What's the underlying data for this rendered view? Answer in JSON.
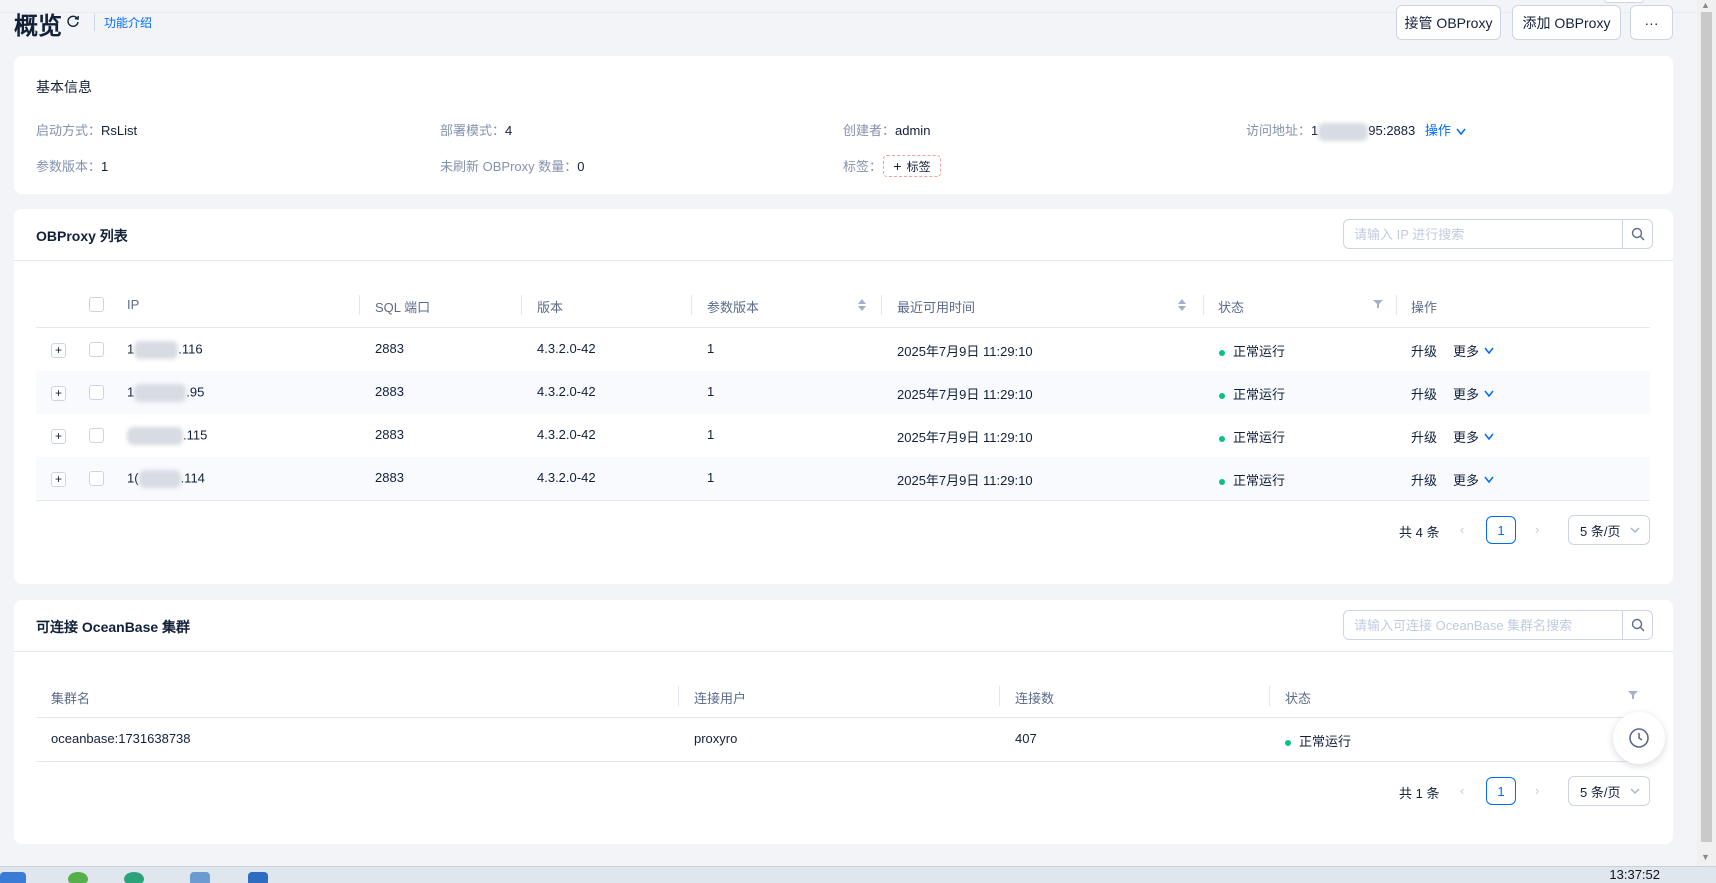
{
  "header": {
    "title": "概览",
    "intro_link": "功能介绍",
    "btn_takeover": "接管 OBProxy",
    "btn_add": "添加 OBProxy",
    "btn_more": "···"
  },
  "basic_info": {
    "title": "基本信息",
    "start_mode_label": "启动方式：",
    "start_mode_value": "RsList",
    "deploy_mode_label": "部署模式：",
    "deploy_mode_value": "4",
    "creator_label": "创建者：",
    "creator_value": "admin",
    "address_label": "访问地址：",
    "address_prefix": "1",
    "address_suffix": "95:2883",
    "address_action": "操作",
    "param_version_label": "参数版本：",
    "param_version_value": "1",
    "unrefreshed_label": "未刷新 OBProxy 数量：",
    "unrefreshed_value": "0",
    "tags_label": "标签：",
    "tag_add": "标签"
  },
  "obproxy": {
    "title": "OBProxy 列表",
    "search_placeholder": "请输入 IP 进行搜索",
    "columns": [
      "IP",
      "SQL 端口",
      "版本",
      "参数版本",
      "最近可用时间",
      "状态",
      "操作"
    ],
    "rows": [
      {
        "ip_prefix": "1",
        "ip_suffix": ".116",
        "port": "2883",
        "version": "4.3.2.0-42",
        "param_version": "1",
        "time": "2025年7月9日 11:29:10",
        "status": "正常运行",
        "upgrade": "升级",
        "more": "更多"
      },
      {
        "ip_prefix": "1",
        "ip_suffix": ".95",
        "port": "2883",
        "version": "4.3.2.0-42",
        "param_version": "1",
        "time": "2025年7月9日 11:29:10",
        "status": "正常运行",
        "upgrade": "升级",
        "more": "更多"
      },
      {
        "ip_prefix": "",
        "ip_suffix": ".115",
        "port": "2883",
        "version": "4.3.2.0-42",
        "param_version": "1",
        "time": "2025年7月9日 11:29:10",
        "status": "正常运行",
        "upgrade": "升级",
        "more": "更多"
      },
      {
        "ip_prefix": "1(",
        "ip_suffix": ".114",
        "port": "2883",
        "version": "4.3.2.0-42",
        "param_version": "1",
        "time": "2025年7月9日 11:29:10",
        "status": "正常运行",
        "upgrade": "升级",
        "more": "更多"
      }
    ],
    "pagination": {
      "total": "共 4 条",
      "page": "1",
      "page_size": "5 条/页"
    }
  },
  "clusters": {
    "title": "可连接 OceanBase 集群",
    "search_placeholder": "请输入可连接 OceanBase 集群名搜索",
    "columns": [
      "集群名",
      "连接用户",
      "连接数",
      "状态"
    ],
    "rows": [
      {
        "name": "oceanbase:1731638738",
        "user": "proxyro",
        "connections": "407",
        "status": "正常运行"
      }
    ],
    "pagination": {
      "total": "共 1 条",
      "page": "1",
      "page_size": "5 条/页"
    }
  },
  "taskbar": {
    "clock": "13:37:52"
  },
  "colors": {
    "brand": "#006aff",
    "status_ok": "#0ac185",
    "text": "#132039",
    "muted": "#8592ad"
  }
}
